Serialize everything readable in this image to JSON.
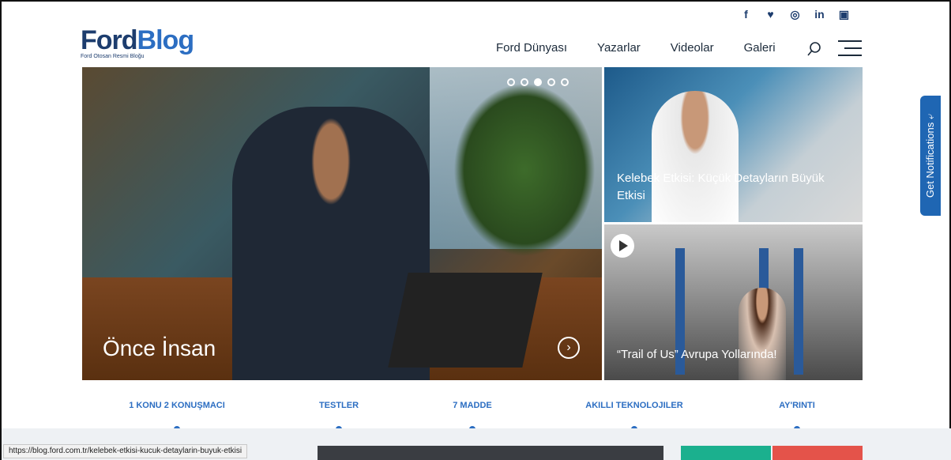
{
  "social": [
    "f",
    "♥",
    "◎",
    "in",
    "▣"
  ],
  "logo": {
    "ford": "Ford",
    "blog": "Blog",
    "tagline": "Ford Otosan Resmi Bloğu"
  },
  "nav": [
    "Ford Dünyası",
    "Yazarlar",
    "Videolar",
    "Galeri"
  ],
  "hero": {
    "title": "Önce İnsan",
    "next_icon": "›"
  },
  "cards": [
    {
      "title": "Kelebek Etkisi: Küçük Detayların Büyük Etkisi"
    },
    {
      "title": "“Trail of Us” Avrupa Yollarında!"
    }
  ],
  "categories": [
    "1 Konu 2 Konuşmacı",
    "Testler",
    "7 Madde",
    "Akıllı Teknolojiler",
    "Ay'rıntı"
  ],
  "notification": "Get Notifications ⤶",
  "status_url": "https://blog.ford.com.tr/kelebek-etkisi-kucuk-detaylarin-buyuk-etkisi"
}
